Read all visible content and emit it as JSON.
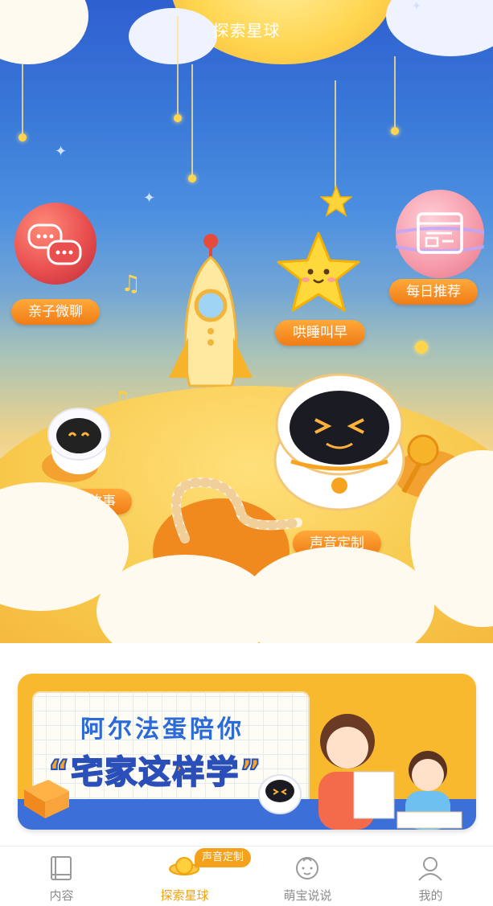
{
  "header": {
    "title": "探索星球"
  },
  "features": {
    "parent_chat": "亲子微聊",
    "daily_recommend": "每日推荐",
    "sleep_wake": "哄睡叫早",
    "record_story": "录制故事",
    "voice_custom": "声音定制"
  },
  "banner": {
    "line1": "阿尔法蛋陪你",
    "line2": "“宅家这样学”"
  },
  "tabbar": {
    "tooltip": "声音定制",
    "items": [
      {
        "label": "内容",
        "icon": "book-icon"
      },
      {
        "label": "探索星球",
        "icon": "planet-icon"
      },
      {
        "label": "萌宝说说",
        "icon": "baby-icon"
      },
      {
        "label": "我的",
        "icon": "user-icon"
      }
    ],
    "active_index": 1
  },
  "colors": {
    "sky_top": "#2f5fd0",
    "label_orange": "#f07c16",
    "banner_yellow": "#f8b92e",
    "tab_active": "#f2a20b",
    "tab_inactive": "#8b8b8b"
  }
}
